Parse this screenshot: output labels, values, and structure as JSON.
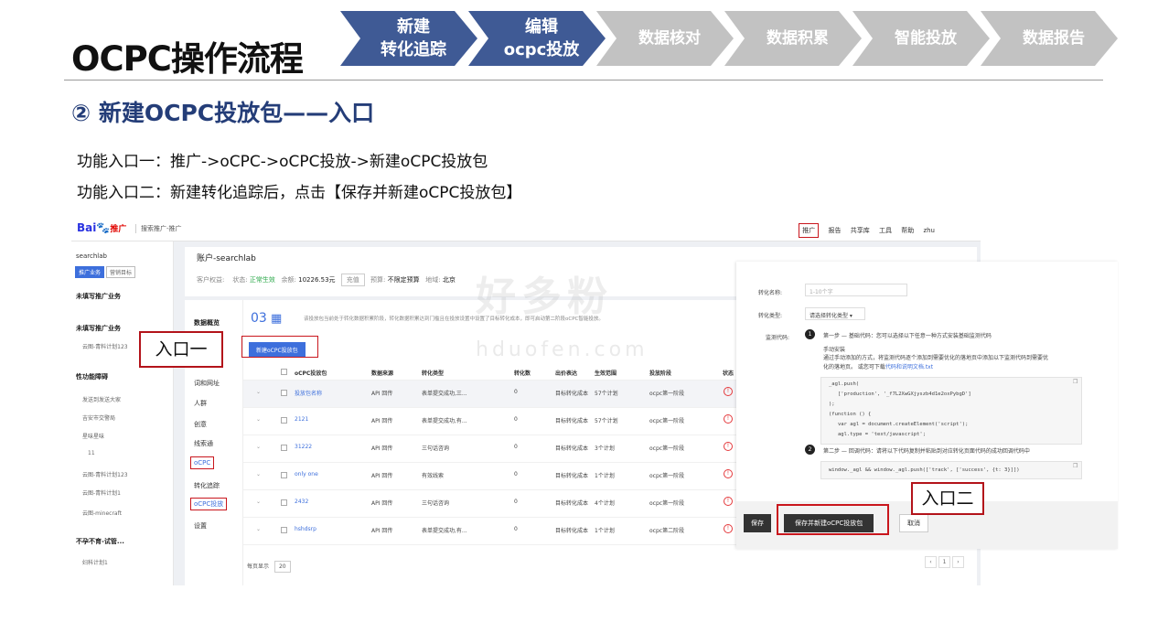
{
  "title": "OCPC操作流程",
  "steps": [
    {
      "line1": "新建",
      "line2": "转化追踪",
      "state": "active"
    },
    {
      "line1": "编辑",
      "line2": "ocpc投放",
      "state": "active"
    },
    {
      "line1": "数据核对",
      "line2": "",
      "state": "inactive"
    },
    {
      "line1": "数据积累",
      "line2": "",
      "state": "inactive"
    },
    {
      "line1": "智能投放",
      "line2": "",
      "state": "inactive"
    },
    {
      "line1": "数据报告",
      "line2": "",
      "state": "inactive"
    }
  ],
  "colors": {
    "step_active": "#3f5a95",
    "step_inactive": "#c2c2c2",
    "highlight": "#c9161d",
    "section_title": "#243d78"
  },
  "section_title": "② 新建OCPC投放包——入口",
  "entry1": "功能入口一：推广->oCPC->oCPC投放->新建oCPC投放包",
  "entry2": "功能入口二：新建转化追踪后，点击【保存并新建oCPC投放包】",
  "callouts": {
    "one": "入口一",
    "two": "入口二"
  },
  "watermark": {
    "cn": "好多粉",
    "en": "hduofen.com"
  },
  "screenshot": {
    "logo_text": "Bai",
    "logo_paw": "🐾",
    "logo_sub": "推广",
    "brand": "搜索推广-推广",
    "topnav": [
      "推广",
      "报告",
      "共享库",
      "工具",
      "帮助",
      "zhu"
    ],
    "account": "searchlab",
    "side_tabs": [
      "推广业务",
      "营销目标"
    ],
    "side": {
      "unfilled": "未填写推广业务",
      "group1": "未填写推广业务",
      "g1_item": "云图-青料计划123",
      "group2": "性功能障碍",
      "g2_items": [
        "发送到发送大家",
        "吉安市交警局",
        "星味星味",
        "11",
        "云图-青料计划123",
        "云图-青料计划1",
        "云图-minecraft"
      ],
      "group3": "不孕不育-试管...",
      "g3_item": "妇科计划1"
    },
    "account_bar": {
      "name": "账户-searchlab",
      "rights_label": "客户权益:",
      "status_label": "状态:",
      "status_value": "正常生效",
      "balance_label": "余额:",
      "balance_value": "10226.53元",
      "recharge": "充值",
      "budget_label": "预算:",
      "budget_value": "不限定预算",
      "region_label": "地域:",
      "region_value": "北京"
    },
    "nav": {
      "overview": "数据概览",
      "words": "词和网址",
      "crowd": "人群",
      "creative": "创意",
      "leads": "线索通",
      "ocpc": "oCPC",
      "conv_track": "转化追踪",
      "ocpc_launch": "oCPC投放",
      "settings": "设置"
    },
    "table": {
      "step_num": "03",
      "tip": "该投放包当前处于转化数据积累阶段，转化数据积累达到门槛且在投放设置中设置了目标转化成本，即可启动第二阶段oCPC智能投放。",
      "new_button": "新建oCPC投放包",
      "headers": [
        "oCPC投放包",
        "数据来源",
        "转化类型",
        "转化数",
        "出价表达",
        "生效范围",
        "投放阶段",
        "状态"
      ],
      "rows": [
        [
          "投放包名称",
          "API 回传",
          "表单提交成功,三...",
          "0",
          "目标转化成本",
          "57个计划",
          "ocpc第一阶段"
        ],
        [
          "2121",
          "API 回传",
          "表单提交成功,有...",
          "0",
          "目标转化成本",
          "57个计划",
          "ocpc第一阶段"
        ],
        [
          "31222",
          "API 回传",
          "三句话咨询",
          "0",
          "目标转化成本",
          "3个计划",
          "ocpc第一阶段"
        ],
        [
          "only one",
          "API 回传",
          "有效线索",
          "0",
          "目标转化成本",
          "1个计划",
          "ocpc第一阶段"
        ],
        [
          "2432",
          "API 回传",
          "三句话咨询",
          "0",
          "目标转化成本",
          "4个计划",
          "ocpc第一阶段"
        ],
        [
          "hshdsrp",
          "API 回传",
          "表单提交成功,有...",
          "0",
          "目标转化成本",
          "1个计划",
          "ocpc第二阶段"
        ]
      ],
      "status_glyph": "!",
      "page_size_label": "每页显示",
      "page_size": "20",
      "page_num": "1"
    },
    "panel": {
      "conv_name_label": "转化名称:",
      "conv_name_placeholder": "1-10个字",
      "conv_type_label": "转化类型:",
      "conv_type_value": "请选择转化类型",
      "monitor_label": "监测代码:",
      "step1_num": "1",
      "step1_title": "第一步 — 基础代码：您可以选择以下任意一种方式安装基础监测代码",
      "manual_label": "手动安装",
      "manual_desc1": "通过手动添加的方式，将监测代码逐个添加到需要优化的落地页中添加以下监测代码到需要优",
      "manual_desc2": "化的落地页。 或您可下载",
      "manual_link": "代码和说明文档.txt",
      "code_lines": [
        "_agl.push(",
        "['production', '_f7L2XwGXjyszb4d1e2oxPybgD']",
        ");",
        "(function () {",
        "var agl = document.createElement('script');",
        "agl.type = 'text/javascript';"
      ],
      "step2_num": "2",
      "step2_title": "第二步 — 回调代码：请将以下代码复制并粘贴到对应转化页面代码的成功回调代码中",
      "step2_code": "window._agl && window._agl.push(['track', ['success', {t: 3}]])",
      "save": "保存",
      "save_new": "保存并新建oCPC投放包",
      "cancel": "取消"
    }
  }
}
